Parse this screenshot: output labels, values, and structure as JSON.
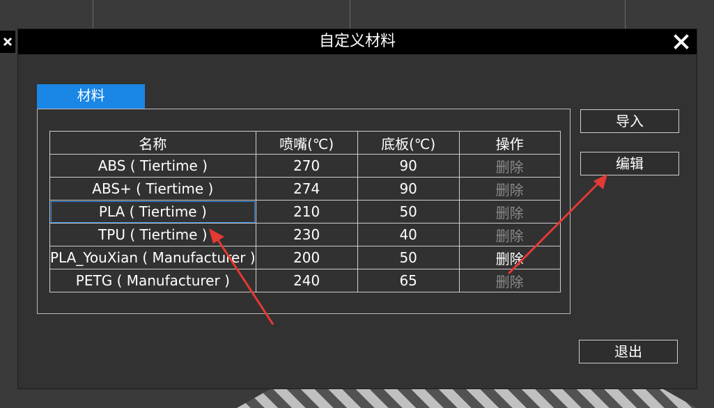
{
  "dialog": {
    "title": "自定义材料"
  },
  "tabs": [
    {
      "label": "材料"
    }
  ],
  "table": {
    "headers": [
      "名称",
      "喷嘴(℃)",
      "底板(℃)",
      "操作"
    ],
    "rows": [
      {
        "name": "ABS ( Tiertime )",
        "nozzle": "270",
        "bed": "90",
        "action": "删除",
        "action_enabled": false
      },
      {
        "name": "ABS+ ( Tiertime )",
        "nozzle": "274",
        "bed": "90",
        "action": "删除",
        "action_enabled": false
      },
      {
        "name": "PLA ( Tiertime )",
        "nozzle": "210",
        "bed": "50",
        "action": "删除",
        "action_enabled": false,
        "selected": true
      },
      {
        "name": "TPU ( Tiertime )",
        "nozzle": "230",
        "bed": "40",
        "action": "删除",
        "action_enabled": false
      },
      {
        "name": "PLA_YouXian ( Manufacturer )",
        "nozzle": "200",
        "bed": "50",
        "action": "删除",
        "action_enabled": true
      },
      {
        "name": "PETG ( Manufacturer )",
        "nozzle": "240",
        "bed": "65",
        "action": "删除",
        "action_enabled": false
      }
    ]
  },
  "buttons": {
    "import": "导入",
    "edit": "编辑",
    "exit": "退出"
  },
  "colors": {
    "accent": "#1a86e6",
    "annotation_arrow": "#e53935"
  },
  "icons": {
    "close": "close-icon"
  }
}
